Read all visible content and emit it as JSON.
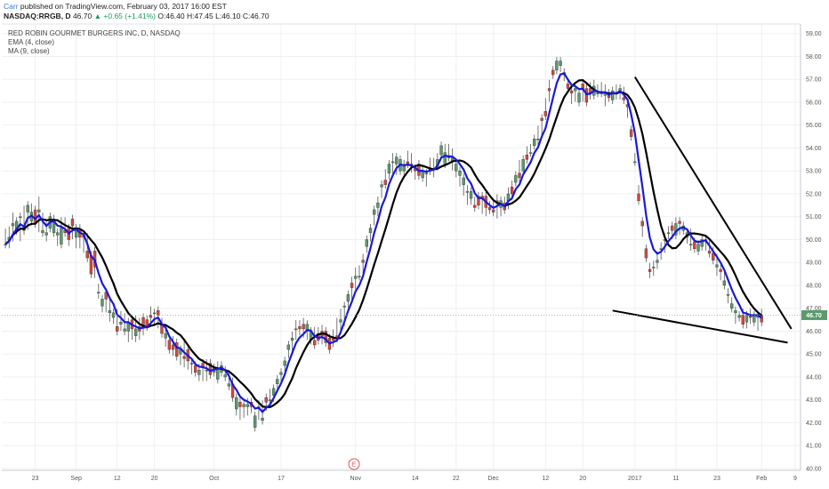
{
  "header": {
    "author": "Carr",
    "published": "published on TradingView.com, February 03, 2017 16:00 EST",
    "symbol": "NASDAQ:RRGB, D",
    "last": "46.70",
    "change": "+0.65 (+1.41%)",
    "ohlc": "O:46.40 H:47.45 L:46.10 C:46.70"
  },
  "legend": {
    "title": "RED ROBIN GOURMET BURGERS INC, D, NASDAQ",
    "ema": "EMA (4, close)",
    "ma": "MA (9, close)"
  },
  "price_label": "46.70",
  "event_marker": "E",
  "colors": {
    "up": "#5b9a6e",
    "down": "#d9473c",
    "ema": "#1a1ad6",
    "ma": "#000000",
    "trendline": "#000000"
  },
  "chart_data": {
    "type": "candlestick",
    "ylim": [
      40,
      59.3
    ],
    "y_ticks": [
      "40.00",
      "41.00",
      "42.00",
      "43.00",
      "44.00",
      "45.00",
      "46.00",
      "47.00",
      "48.00",
      "49.00",
      "50.00",
      "51.00",
      "52.00",
      "53.00",
      "54.00",
      "55.00",
      "56.00",
      "57.00",
      "58.00",
      "59.00"
    ],
    "x_ticks": [
      "23",
      "Sep",
      "12",
      "20",
      "Oct",
      "17",
      "Nov",
      "14",
      "22",
      "Dec",
      "12",
      "20",
      "2017",
      "11",
      "23",
      "Feb",
      "9"
    ],
    "x_tick_index": [
      8,
      19,
      30,
      40,
      56,
      74,
      94,
      110,
      121,
      131,
      145,
      155,
      169,
      180,
      191,
      203,
      212
    ],
    "num_bars": 213,
    "candles": [
      [
        49.8,
        50.1,
        49.9,
        49.8,
        50.3
      ],
      [
        50.0,
        49.9,
        49.8,
        50.1,
        50.4
      ],
      [
        50.6,
        50.8,
        50.1,
        50.7,
        51.0
      ],
      [
        50.4,
        50.4,
        50.7,
        50.8,
        50.6
      ],
      [
        51.0,
        50.1,
        51.0,
        51.0,
        50.1
      ],
      [
        50.6,
        50.6,
        51.3,
        50.4,
        50.9
      ],
      [
        51.2,
        51.3,
        50.9,
        51.5,
        50.6
      ],
      [
        50.8,
        51.4,
        51.4,
        51.2,
        51.2
      ],
      [
        51.3,
        51.1,
        51.3,
        50.7,
        50.8
      ],
      [
        51.2,
        50.5,
        51.1,
        51.3,
        51.7
      ],
      [
        50.3,
        50.5,
        51.0,
        50.4,
        50.6
      ],
      [
        50.2,
        50.5,
        50.6,
        50.3,
        50.1
      ],
      [
        50.5,
        50.7,
        50.9,
        51.0,
        51.0
      ],
      [
        50.3,
        50.6,
        50.6,
        50.9,
        50.8
      ],
      [
        50.2,
        50.1,
        50.1,
        50.3,
        49.9
      ],
      [
        49.8,
        50.6,
        50.8,
        50.5,
        50.3
      ],
      [
        50.4,
        50.7,
        50.6,
        50.3,
        50.8
      ],
      [
        50.5,
        50.5,
        50.5,
        50.0,
        49.9
      ],
      [
        50.9,
        50.6,
        50.2,
        50.6,
        50.4
      ],
      [
        50.1,
        50.3,
        50.0,
        50.5,
        49.8
      ],
      [
        50.4,
        50.5,
        49.8,
        50.1,
        50.2
      ],
      [
        50.2,
        49.6,
        49.6,
        50.1,
        50.0
      ],
      [
        49.5,
        49.5,
        50.1,
        49.2,
        49.2
      ],
      [
        49.3,
        48.9,
        49.3,
        48.5,
        49.2
      ],
      [
        49.5,
        48.5,
        48.5,
        48.8,
        48.5
      ],
      [
        47.7,
        47.9,
        47.6,
        47.7,
        47.8
      ],
      [
        47.1,
        47.0,
        47.1,
        47.4,
        47.1
      ],
      [
        47.7,
        47.3,
        47.6,
        47.4,
        47.0
      ],
      [
        46.8,
        46.6,
        46.6,
        46.9,
        47.2
      ],
      [
        46.6,
        46.6,
        46.5,
        46.8,
        46.6
      ],
      [
        46.2,
        46.3,
        46.3,
        46.0,
        46.8
      ],
      [
        46.3,
        46.5,
        46.7,
        46.4,
        46.2
      ],
      [
        46.0,
        46.3,
        46.6,
        46.1,
        46.6
      ],
      [
        46.0,
        46.2,
        46.0,
        46.4,
        45.7
      ],
      [
        46.5,
        46.3,
        45.8,
        46.1,
        46.0
      ],
      [
        45.8,
        46.5,
        45.7,
        46.1,
        46.3
      ],
      [
        46.2,
        46.2,
        46.4,
        46.0,
        45.8
      ],
      [
        46.6,
        46.1,
        46.0,
        46.2,
        46.3
      ],
      [
        46.5,
        46.3,
        46.5,
        46.2,
        46.2
      ],
      [
        46.7,
        46.4,
        46.6,
        46.6,
        46.9
      ],
      [
        46.8,
        46.4,
        46.4,
        46.8,
        46.6
      ],
      [
        46.9,
        46.8,
        46.3,
        46.7,
        46.5
      ],
      [
        46.3,
        46.4,
        45.9,
        45.9,
        46.2
      ],
      [
        45.7,
        45.6,
        45.5,
        45.9,
        45.7
      ],
      [
        45.6,
        45.4,
        45.6,
        45.2,
        45.6
      ],
      [
        45.4,
        45.1,
        45.3,
        45.2,
        45.6
      ],
      [
        45.5,
        45.2,
        45.0,
        44.9,
        45.2
      ],
      [
        45.0,
        45.0,
        44.9,
        45.2,
        44.7
      ],
      [
        44.9,
        45.4,
        45.0,
        44.8,
        44.6
      ],
      [
        45.2,
        45.0,
        44.5,
        44.7,
        44.8
      ],
      [
        44.6,
        44.5,
        44.4,
        44.6,
        44.3
      ],
      [
        44.5,
        44.4,
        44.2,
        44.2,
        44.2
      ],
      [
        44.1,
        44.4,
        44.2,
        44.3,
        44.0
      ],
      [
        44.6,
        44.2,
        44.5,
        44.4,
        44.0
      ],
      [
        44.3,
        44.5,
        44.6,
        44.3,
        44.0
      ],
      [
        44.6,
        44.6,
        44.3,
        44.1,
        44.2
      ],
      [
        44.2,
        44.4,
        44.2,
        44.4,
        44.3
      ],
      [
        43.9,
        44.2,
        44.2,
        44.4,
        44.5
      ],
      [
        44.2,
        44.3,
        44.2,
        44.5,
        44.4
      ],
      [
        44.0,
        44.0,
        44.0,
        44.1,
        44.3
      ],
      [
        43.6,
        43.7,
        43.6,
        43.7,
        44.1
      ],
      [
        43.7,
        43.4,
        43.5,
        43.1,
        43.8
      ],
      [
        42.6,
        43.1,
        42.5,
        43.1,
        42.9
      ],
      [
        42.9,
        42.9,
        42.7,
        42.7,
        42.3
      ],
      [
        42.7,
        42.4,
        42.6,
        42.8,
        42.7
      ],
      [
        42.7,
        42.8,
        42.9,
        42.8,
        42.5
      ],
      [
        42.9,
        42.9,
        42.6,
        42.7,
        42.9
      ],
      [
        41.8,
        42.2,
        42.0,
        42.3,
        42.2
      ],
      [
        42.7,
        42.5,
        42.8,
        42.7,
        42.3
      ],
      [
        42.1,
        42.5,
        42.8,
        42.2,
        42.4
      ],
      [
        43.1,
        43.1,
        42.7,
        42.9,
        42.8
      ],
      [
        43.0,
        43.1,
        43.3,
        43.0,
        43.0
      ],
      [
        43.2,
        43.1,
        43.3,
        43.5,
        43.2
      ],
      [
        43.7,
        43.5,
        43.8,
        43.9,
        43.6
      ],
      [
        44.1,
        44.0,
        44.0,
        44.2,
        44.0
      ],
      [
        44.5,
        44.5,
        44.6,
        44.7,
        44.4
      ],
      [
        45.2,
        45.0,
        45.3,
        45.4,
        45.1
      ],
      [
        45.6,
        45.8,
        45.3,
        45.7,
        45.5
      ],
      [
        46.1,
        46.0,
        46.3,
        46.1,
        45.8
      ],
      [
        46.2,
        46.2,
        46.3,
        46.1,
        46.0
      ],
      [
        46.3,
        46.1,
        45.9,
        46.1,
        46.4
      ],
      [
        46.0,
        46.1,
        45.9,
        46.3,
        45.8
      ],
      [
        45.6,
        45.6,
        45.6,
        46.0,
        45.8
      ],
      [
        45.6,
        46.0,
        45.6,
        45.4,
        45.7
      ],
      [
        45.9,
        46.0,
        46.0,
        45.6,
        45.6
      ],
      [
        46.0,
        45.6,
        45.9,
        45.8,
        46.1
      ],
      [
        46.0,
        45.5,
        45.9,
        45.5,
        45.7
      ],
      [
        45.7,
        45.5,
        45.7,
        45.2,
        45.3
      ],
      [
        45.7,
        45.9,
        45.5,
        45.6,
        45.7
      ],
      [
        45.8,
        46.3,
        46.1,
        45.7,
        46.4
      ],
      [
        46.4,
        46.5,
        46.8,
        46.5,
        46.1
      ],
      [
        47.1,
        46.7,
        46.7,
        47.1,
        46.4
      ],
      [
        47.3,
        47.2,
        47.5,
        47.6,
        47.3
      ],
      [
        48.1,
        47.5,
        48.2,
        47.9,
        48.0
      ],
      [
        48.3,
        48.1,
        48.6,
        48.4,
        48.0
      ],
      [
        48.4,
        48.5,
        48.7,
        48.4,
        48.7
      ],
      [
        49.1,
        49.0,
        48.7,
        49.0,
        49.2
      ],
      [
        49.7,
        49.6,
        49.8,
        50.0,
        49.9
      ],
      [
        50.3,
        50.1,
        50.2,
        50.5,
        50.4
      ],
      [
        51.1,
        51.0,
        50.8,
        51.3,
        51.0
      ],
      [
        51.4,
        51.7,
        51.4,
        51.6,
        51.2
      ],
      [
        52.3,
        52.0,
        52.1,
        52.4,
        52.0
      ],
      [
        52.6,
        52.6,
        52.9,
        52.4,
        52.6
      ],
      [
        52.9,
        52.9,
        52.8,
        53.3,
        53.2
      ],
      [
        53.4,
        53.0,
        53.6,
        53.4,
        53.5
      ],
      [
        53.3,
        53.0,
        53.4,
        53.6,
        53.2
      ],
      [
        53.0,
        53.4,
        53.0,
        53.5,
        53.5
      ],
      [
        53.0,
        53.3,
        53.1,
        53.2,
        53.2
      ],
      [
        53.4,
        53.3,
        53.7,
        53.3,
        53.4
      ],
      [
        53.3,
        53.1,
        53.6,
        53.2,
        53.2
      ],
      [
        53.1,
        53.0,
        52.9,
        53.0,
        52.8
      ],
      [
        53.3,
        52.9,
        53.0,
        52.8,
        52.9
      ],
      [
        52.7,
        52.8,
        52.7,
        53.0,
        52.8
      ],
      [
        52.9,
        52.9,
        52.5,
        52.9,
        52.8
      ],
      [
        53.1,
        53.2,
        53.4,
        53.1,
        53.0
      ],
      [
        53.1,
        53.3,
        52.9,
        53.1,
        53.4
      ],
      [
        53.2,
        53.2,
        53.6,
        53.5,
        53.4
      ],
      [
        53.7,
        53.9,
        54.1,
        54.1,
        53.8
      ],
      [
        53.3,
        54.0,
        53.7,
        53.8,
        53.9
      ],
      [
        53.6,
        53.8,
        54.0,
        53.6,
        53.9
      ],
      [
        53.4,
        53.4,
        53.2,
        53.6,
        53.8
      ],
      [
        53.0,
        53.2,
        53.0,
        53.3,
        52.9
      ],
      [
        52.8,
        52.8,
        52.5,
        53.0,
        52.8
      ],
      [
        52.4,
        52.4,
        52.1,
        52.7,
        52.7
      ],
      [
        52.1,
        52.0,
        52.2,
        52.1,
        51.7
      ],
      [
        51.8,
        51.8,
        51.9,
        52.1,
        51.7
      ],
      [
        51.5,
        51.6,
        51.7,
        51.4,
        51.7
      ],
      [
        51.9,
        51.6,
        51.6,
        51.5,
        51.8
      ],
      [
        51.9,
        51.3,
        51.5,
        51.8,
        51.6
      ],
      [
        51.9,
        51.6,
        51.8,
        51.4,
        51.2
      ],
      [
        51.4,
        51.5,
        51.3,
        51.3,
        51.5
      ],
      [
        51.3,
        51.5,
        51.6,
        51.2,
        51.6
      ],
      [
        51.7,
        51.4,
        51.1,
        51.6,
        51.8
      ],
      [
        51.4,
        51.2,
        51.5,
        51.7,
        51.6
      ],
      [
        51.6,
        51.7,
        51.6,
        51.3,
        51.6
      ],
      [
        51.7,
        52.1,
        51.5,
        52.0,
        52.1
      ],
      [
        52.3,
        51.9,
        52.4,
        52.0,
        52.4
      ],
      [
        52.5,
        52.6,
        52.5,
        52.8,
        52.6
      ],
      [
        52.9,
        53.2,
        53.0,
        52.7,
        53.3
      ],
      [
        53.0,
        53.4,
        53.5,
        53.5,
        53.3
      ],
      [
        53.7,
        53.8,
        53.7,
        53.5,
        53.9
      ],
      [
        53.8,
        53.9,
        53.9,
        53.8,
        54.0
      ],
      [
        54.1,
        54.2,
        54.3,
        54.4,
        54.3
      ],
      [
        54.4,
        54.3,
        54.6,
        54.4,
        54.8
      ],
      [
        55.3,
        55.0,
        55.2,
        55.2,
        54.7
      ],
      [
        55.6,
        55.9,
        56.0,
        55.4,
        55.8
      ],
      [
        56.6,
        56.2,
        56.5,
        56.5,
        56.8
      ],
      [
        57.4,
        57.3,
        57.4,
        57.2,
        57.4
      ],
      [
        57.4,
        57.7,
        57.8,
        57.8,
        57.5
      ],
      [
        57.6,
        57.8,
        57.7,
        57.8,
        57.5
      ],
      [
        57.2,
        57.3,
        57.1,
        57.3,
        57.2
      ],
      [
        56.8,
        56.6,
        56.6,
        56.6,
        56.8
      ],
      [
        56.5,
        56.1,
        56.4,
        56.4,
        56.6
      ],
      [
        56.5,
        56.2,
        56.4,
        56.6,
        56.2
      ],
      [
        56.0,
        56.3,
        56.3,
        56.4,
        56.1
      ],
      [
        56.8,
        56.5,
        56.2,
        56.6,
        56.4
      ],
      [
        56.6,
        56.1,
        56.5,
        56.0,
        56.3
      ],
      [
        56.6,
        56.7,
        56.3,
        56.4,
        56.7
      ],
      [
        56.3,
        56.6,
        56.4,
        56.7,
        56.8
      ],
      [
        56.4,
        56.6,
        56.5,
        56.4,
        56.4
      ],
      [
        56.4,
        56.7,
        56.4,
        56.4,
        56.6
      ],
      [
        56.3,
        56.4,
        56.6,
        56.4,
        56.0
      ],
      [
        56.4,
        56.3,
        56.2,
        56.2,
        56.4
      ],
      [
        56.1,
        56.2,
        56.1,
        56.5,
        56.2
      ],
      [
        56.4,
        56.3,
        56.4,
        56.4,
        56.6
      ],
      [
        56.5,
        56.5,
        56.3,
        56.6,
        56.5
      ],
      [
        56.2,
        56.5,
        56.1,
        56.1,
        56.5
      ],
      [
        55.9,
        55.5,
        55.6,
        55.8,
        55.5
      ],
      [
        54.8,
        54.8,
        54.7,
        54.5,
        54.8
      ],
      [
        53.4,
        53.4,
        53.6,
        53.4,
        53.6
      ],
      [
        52.0,
        51.9,
        52.2,
        51.7,
        52.1
      ],
      [
        50.8,
        50.3,
        50.4,
        50.6,
        50.5
      ],
      [
        49.6,
        49.5,
        49.5,
        49.2,
        49.6
      ],
      [
        48.7,
        48.8,
        48.5,
        48.6,
        48.5
      ],
      [
        48.8,
        48.6,
        48.9,
        48.8,
        48.8
      ],
      [
        49.0,
        49.3,
        49.0,
        49.1,
        48.9
      ],
      [
        49.6,
        49.5,
        49.3,
        49.6,
        49.7
      ],
      [
        50.0,
        50.1,
        50.0,
        50.0,
        49.6
      ],
      [
        50.3,
        50.2,
        50.4,
        50.3,
        50.3
      ],
      [
        50.6,
        50.5,
        50.5,
        50.4,
        50.2
      ],
      [
        50.2,
        50.5,
        50.6,
        50.7,
        50.8
      ],
      [
        50.8,
        50.4,
        50.5,
        50.7,
        50.8
      ],
      [
        50.4,
        50.5,
        50.6,
        50.6,
        50.4
      ],
      [
        50.1,
        50.0,
        50.3,
        50.3,
        50.1
      ],
      [
        49.8,
        50.1,
        50.3,
        49.8,
        49.7
      ],
      [
        49.9,
        49.8,
        49.7,
        49.6,
        49.9
      ],
      [
        49.5,
        49.7,
        49.5,
        49.8,
        49.8
      ],
      [
        49.7,
        49.7,
        50.0,
        50.0,
        50.0
      ],
      [
        50.0,
        49.7,
        50.0,
        50.0,
        49.9
      ],
      [
        49.5,
        49.8,
        49.8,
        49.4,
        49.4
      ],
      [
        49.4,
        49.2,
        49.5,
        49.1,
        49.4
      ],
      [
        48.8,
        48.8,
        49.2,
        48.9,
        48.6
      ],
      [
        48.7,
        48.6,
        48.6,
        48.6,
        48.4
      ],
      [
        48.0,
        48.1,
        48.4,
        48.2,
        48.1
      ],
      [
        47.6,
        47.4,
        47.4,
        47.6,
        47.7
      ],
      [
        47.0,
        47.1,
        47.3,
        47.2,
        47.1
      ],
      [
        46.8,
        46.6,
        46.8,
        46.9,
        46.5
      ],
      [
        46.6,
        46.7,
        46.7,
        46.7,
        46.6
      ],
      [
        46.7,
        46.5,
        46.8,
        46.3,
        46.7
      ],
      [
        46.4,
        46.3,
        46.4,
        46.7,
        46.4
      ],
      [
        46.7,
        46.5,
        46.8,
        46.6,
        46.5
      ],
      [
        46.4,
        46.4,
        46.7,
        46.7,
        46.6
      ],
      [
        46.6,
        46.5,
        46.2,
        46.7,
        46.6
      ],
      [
        46.7,
        46.8,
        46.7,
        46.4,
        46.7
      ]
    ],
    "trendlines": [
      {
        "x": [
          169,
          211
        ],
        "y": [
          57.1,
          46.1
        ]
      },
      {
        "x": [
          163,
          210
        ],
        "y": [
          46.9,
          45.5
        ]
      }
    ]
  }
}
